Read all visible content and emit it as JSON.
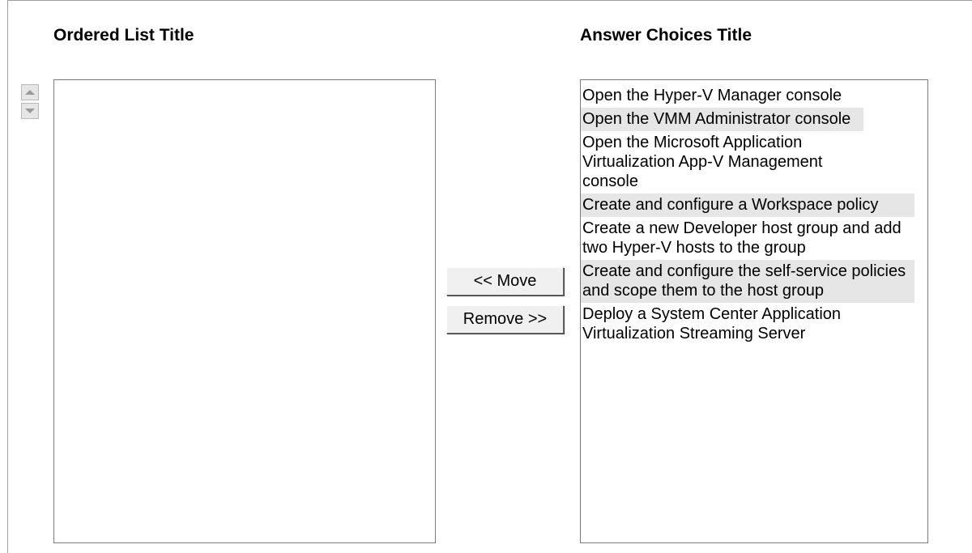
{
  "ordered_list": {
    "title": "Ordered List Title",
    "items": []
  },
  "answer_choices": {
    "title": "Answer Choices Title",
    "items": [
      "Open the Hyper-V Manager console",
      "Open the VMM Administrator console",
      "Open the Microsoft Application Virtualization App-V Management console",
      "Create and configure a Workspace policy",
      "Create a new Developer host group and add two Hyper-V hosts to the group",
      "Create and configure the self-service policies and scope them to the host group",
      "Deploy a System Center Application Virtualization Streaming Server"
    ]
  },
  "buttons": {
    "move_label": "<< Move",
    "remove_label": "Remove >>"
  },
  "icons": {
    "up": "arrow-up-icon",
    "down": "arrow-down-icon"
  },
  "colors": {
    "alt_row": "#e6e6e6",
    "button_face": "#f0f0f0",
    "border": "#7a7a7a"
  }
}
